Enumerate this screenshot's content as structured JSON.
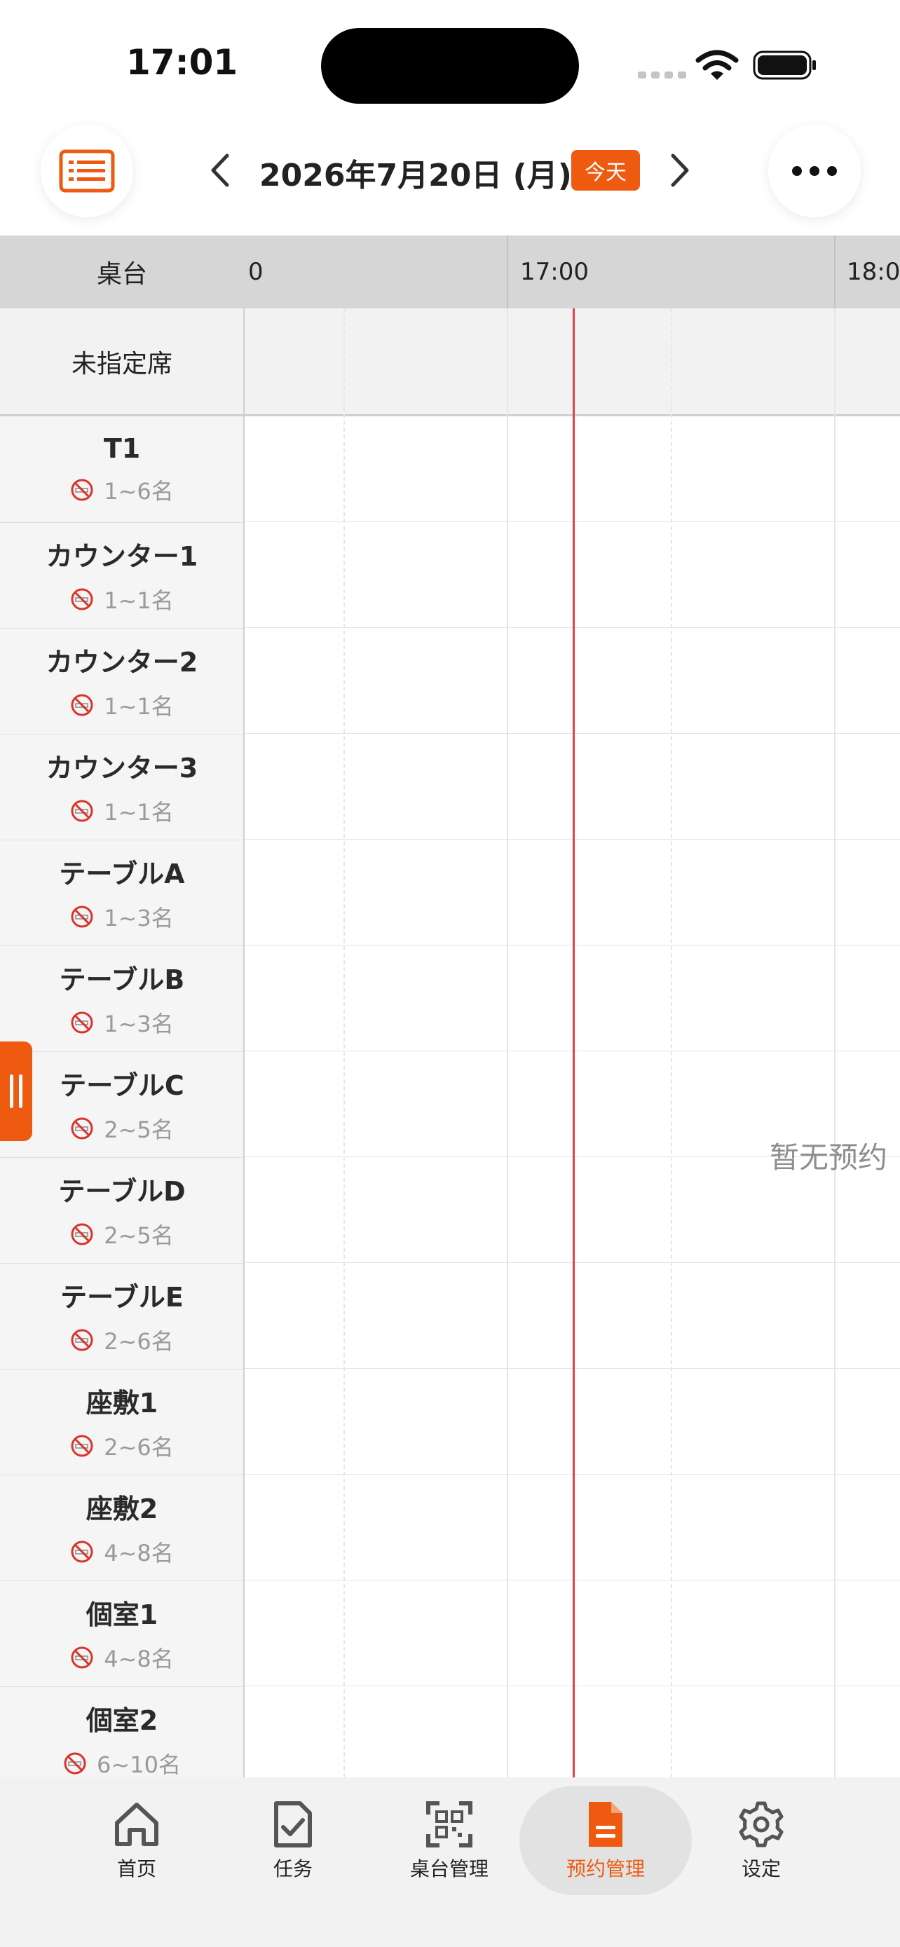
{
  "status": {
    "time": "17:01"
  },
  "header": {
    "date": "2026年7月20日 (月)",
    "today_badge": "今天"
  },
  "grid": {
    "table_column_label": "桌台",
    "time_labels": [
      "0",
      "17:00",
      "18:0"
    ],
    "unassigned_label": "未指定席",
    "empty_text": "暂无预约",
    "current_time_color": "#e0434a"
  },
  "tables": [
    {
      "name": "T1",
      "capacity": "1~6名"
    },
    {
      "name": "カウンター1",
      "capacity": "1~1名"
    },
    {
      "name": "カウンター2",
      "capacity": "1~1名"
    },
    {
      "name": "カウンター3",
      "capacity": "1~1名"
    },
    {
      "name": "テーブルA",
      "capacity": "1~3名"
    },
    {
      "name": "テーブルB",
      "capacity": "1~3名"
    },
    {
      "name": "テーブルC",
      "capacity": "2~5名"
    },
    {
      "name": "テーブルD",
      "capacity": "2~5名"
    },
    {
      "name": "テーブルE",
      "capacity": "2~6名"
    },
    {
      "name": "座敷1",
      "capacity": "2~6名"
    },
    {
      "name": "座敷2",
      "capacity": "4~8名"
    },
    {
      "name": "個室1",
      "capacity": "4~8名"
    },
    {
      "name": "個室2",
      "capacity": "6~10名"
    }
  ],
  "nav": {
    "items": [
      {
        "label": "首页",
        "icon": "home-icon"
      },
      {
        "label": "任务",
        "icon": "task-check-icon"
      },
      {
        "label": "桌台管理",
        "icon": "qr-scan-icon"
      },
      {
        "label": "预约管理",
        "icon": "document-icon"
      },
      {
        "label": "设定",
        "icon": "gear-icon"
      }
    ],
    "active": "预约管理"
  },
  "colors": {
    "accent": "#ee5a0f",
    "no_smoking": "#d9342b"
  }
}
